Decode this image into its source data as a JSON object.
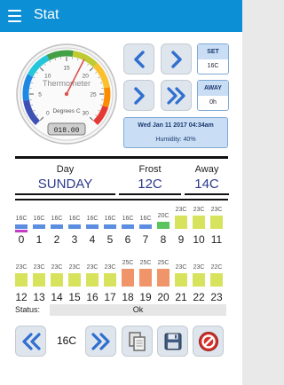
{
  "app": {
    "title": "Stat"
  },
  "gauge": {
    "label": "Thermometer",
    "unit": "Degrees C",
    "reading": "018.00",
    "ticks": [
      "0",
      "5",
      "10",
      "15",
      "20",
      "25",
      "30"
    ],
    "min": 0,
    "max": 30,
    "value": 18
  },
  "set_panel": {
    "caption": "SET",
    "value": "16C"
  },
  "away_panel": {
    "caption": "AWAY",
    "value": "0h"
  },
  "datetime": "Wed Jan 11 2017 04:34am",
  "humidity": "Humidity: 40%",
  "modes": {
    "day": {
      "label": "Day",
      "value": "SUNDAY"
    },
    "frost": {
      "label": "Frost",
      "value": "12C"
    },
    "away": {
      "label": "Away",
      "value": "14C"
    }
  },
  "schedule": {
    "rows": [
      {
        "hours": [
          "0",
          "1",
          "2",
          "3",
          "4",
          "5",
          "6",
          "7",
          "8",
          "9",
          "10",
          "11"
        ],
        "temps": [
          "16C",
          "16C",
          "16C",
          "16C",
          "16C",
          "16C",
          "16C",
          "16C",
          "20C",
          "23C",
          "23C",
          "23C"
        ],
        "levels": [
          "low",
          "low",
          "low",
          "low",
          "low",
          "low",
          "low",
          "low",
          "mid",
          "high",
          "high",
          "high"
        ]
      },
      {
        "hours": [
          "12",
          "13",
          "14",
          "15",
          "16",
          "17",
          "18",
          "19",
          "20",
          "21",
          "22",
          "23"
        ],
        "temps": [
          "23C",
          "23C",
          "23C",
          "23C",
          "23C",
          "23C",
          "25C",
          "25C",
          "25C",
          "23C",
          "23C",
          "22C"
        ],
        "levels": [
          "high",
          "high",
          "high",
          "high",
          "high",
          "high",
          "max",
          "max",
          "max",
          "high",
          "high",
          "high"
        ]
      }
    ],
    "current_hour": 0
  },
  "status": {
    "label": "Status:",
    "value": "Ok"
  },
  "toolbar": {
    "boost_value": "16C"
  },
  "colors": {
    "appbar": "#0d8fd5",
    "arrow": "#2f6fd0",
    "low": "#5b8ee0",
    "mid": "#5cc45c",
    "high": "#d7e25d",
    "max": "#f0956a",
    "current": "#c43bc4"
  }
}
